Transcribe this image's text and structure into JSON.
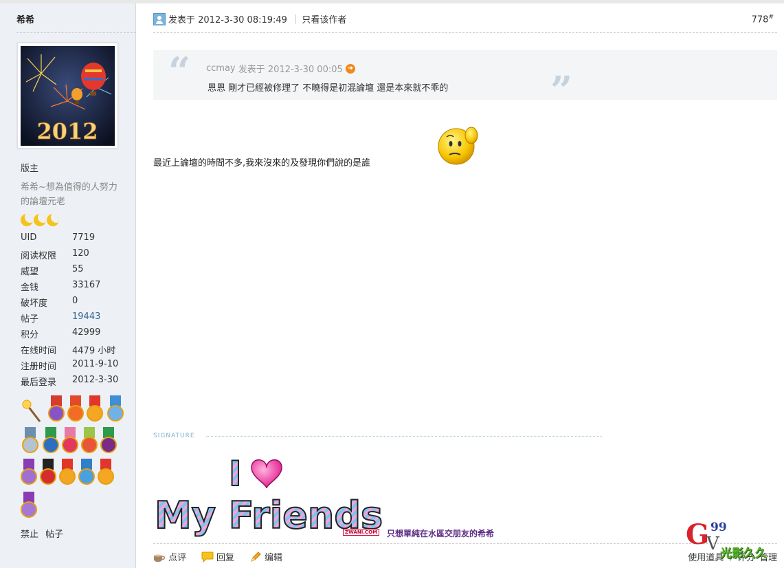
{
  "sidebar": {
    "username": "希希",
    "role": "版主",
    "title_line1": "希希~想為值得的人努力",
    "title_line2": "的論壇元老",
    "stats": [
      {
        "label": "UID",
        "value": "7719"
      },
      {
        "label": "阅读权限",
        "value": "120"
      },
      {
        "label": "威望",
        "value": "55"
      },
      {
        "label": "金钱",
        "value": "33167"
      },
      {
        "label": "破坏度",
        "value": "0"
      },
      {
        "label": "帖子",
        "value": "19443"
      },
      {
        "label": "积分",
        "value": "42999"
      },
      {
        "label": "在线时间",
        "value": "4479 小时"
      },
      {
        "label": "注册时间",
        "value": "2011-9-10"
      },
      {
        "label": "最后登录",
        "value": "2012-3-30"
      }
    ],
    "avatar_text": "2012",
    "ban_label": "禁止",
    "posts_label": "帖子"
  },
  "post": {
    "posted_at": "发表于 2012-3-30 08:19:49",
    "only_author": "只看该作者",
    "floor": "778",
    "floor_mark": "#",
    "quote_author": "ccmay",
    "quote_time": "发表于 2012-3-30 00:05",
    "quote_body": "恩恩 剛才已經被修理了 不曉得是初混論壇 還是本來就不乖的",
    "body": "最近上論壇的時間不多,我來沒來的及發現你們說的是誰",
    "signature_label": "SIGNATURE",
    "sig_caption": "只想單純在水區交朋友的希希",
    "sig_img_line1": "I",
    "sig_img_line2": "My Friends!",
    "zwani": "ZWANI.COM"
  },
  "actions": {
    "rate": "点评",
    "reply": "回复",
    "edit": "编辑",
    "use_tools": "使用道具",
    "grade": "评分",
    "manage": "管理"
  },
  "watermark": {
    "g": "G",
    "nn": "99",
    "v": "V",
    "text": "光影久久"
  },
  "colors": {
    "sidebar_bg": "#edf0f4",
    "link": "#336699",
    "sig_caption": "#5c2c86"
  }
}
